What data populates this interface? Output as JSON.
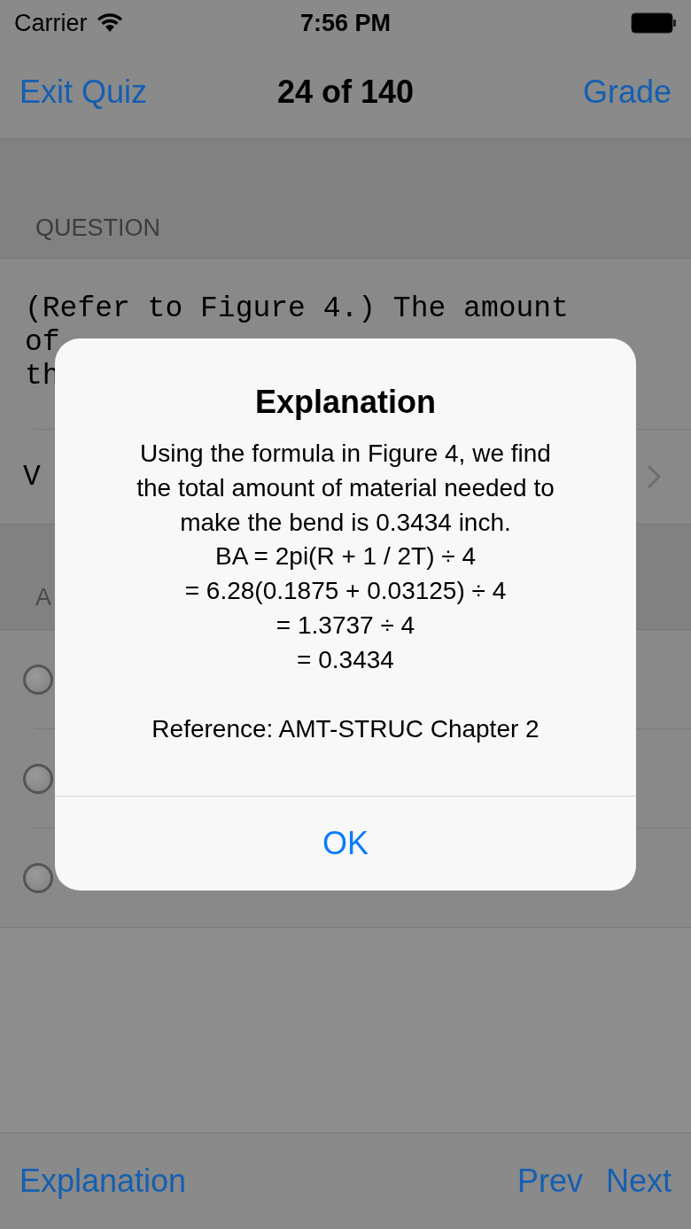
{
  "status_bar": {
    "carrier": "Carrier",
    "time": "7:56 PM"
  },
  "nav_bar": {
    "left_button": "Exit Quiz",
    "title": "24 of 140",
    "right_button": "Grade"
  },
  "question_section": {
    "header": "QUESTION",
    "text_lines": [
      "(Refer to Figure 4.) The amount",
      "of",
      "th"
    ],
    "figure_row": "V"
  },
  "answers_section": {
    "header": "A",
    "answers": [
      {
        "selected": false
      },
      {
        "selected": false
      },
      {
        "selected": false
      }
    ]
  },
  "toolbar": {
    "explanation": "Explanation",
    "prev": "Prev",
    "next": "Next"
  },
  "alert": {
    "title": "Explanation",
    "message_lines": [
      "Using the formula in Figure 4, we find the total amount of material needed to make the bend is 0.3434 inch.",
      "BA = 2pi(R + 1 / 2T) ÷ 4",
      "= 6.28(0.1875 + 0.03125) ÷ 4",
      "= 1.3737 ÷ 4",
      "= 0.3434"
    ],
    "reference": "Reference: AMT-STRUC Chapter 2",
    "button": "OK"
  }
}
